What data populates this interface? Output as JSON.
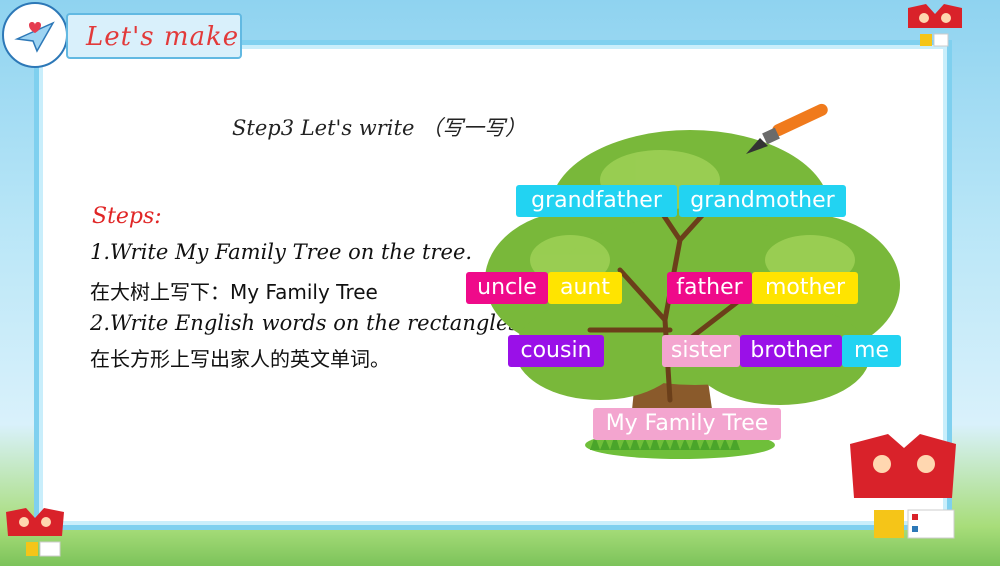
{
  "header": {
    "title": "Let's make"
  },
  "content": {
    "step_title": "Step3 Let's write （写一写）",
    "steps_heading": "Steps:",
    "instructions": [
      "1.Write My Family Tree on the tree.",
      "在大树上写下：My Family Tree",
      "2.Write English words on the rectangles.",
      "在长方形上写出家人的英文单词。"
    ]
  },
  "tree": {
    "words": {
      "grandfather": "grandfather",
      "grandmother": "grandmother",
      "uncle": "uncle",
      "aunt": "aunt",
      "father": "father",
      "mother": "mother",
      "cousin": "cousin",
      "sister": "sister",
      "brother": "brother",
      "me": "me"
    },
    "tree_label": "My Family Tree"
  },
  "colors": {
    "cyan": "#22d3f2",
    "magenta": "#ef0a8a",
    "yellow": "#ffe400",
    "purple": "#9a10e8",
    "pink": "#f3a5cf",
    "title_red": "#e23a3a"
  }
}
